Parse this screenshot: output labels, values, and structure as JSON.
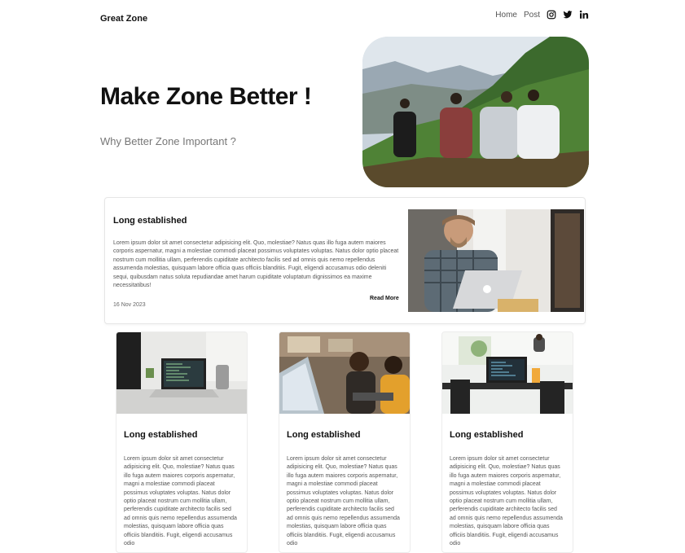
{
  "nav": {
    "brand": "Great Zone",
    "links": [
      "Home",
      "Post"
    ],
    "social_icons": [
      "instagram-icon",
      "twitter-icon",
      "linkedin-icon"
    ]
  },
  "hero": {
    "title": "Make Zone Better !",
    "subtitle": "Why Better Zone Important ?"
  },
  "feature": {
    "title": "Long established",
    "body": "Lorem ipsum dolor sit amet consectetur adipisicing elit. Quo, molestiae? Natus quas illo fuga autem maiores corporis aspernatur, magni a molestiae commodi placeat possimus voluptates voluptas. Natus dolor optio placeat nostrum cum mollitia ullam, perferendis cupiditate architecto facilis sed ad omnis quis nemo repellendus assumenda molestias, quisquam labore officia quas officiis blanditiis. Fugit, eligendi accusamus odio deleniti sequi, quibusdam natus soluta repudiandae amet harum cupiditate voluptatum dignissimos ea maxime necessitatibus!",
    "date": "16 Nov 2023",
    "read_more": "Read More"
  },
  "cards": [
    {
      "title": "Long established",
      "body": "Lorem ipsum dolor sit amet consectetur adipisicing elit. Quo, molestiae? Natus quas illo fuga autem maiores corporis aspernatur, magni a molestiae commodi placeat possimus voluptates voluptas. Natus dolor optio placeat nostrum cum mollitia ullam, perferendis cupiditate architecto facilis sed ad omnis quis nemo repellendus assumenda molestias, quisquam labore officia quas officiis blanditiis. Fugit, eligendi accusamus odio"
    },
    {
      "title": "Long established",
      "body": "Lorem ipsum dolor sit amet consectetur adipisicing elit. Quo, molestiae? Natus quas illo fuga autem maiores corporis aspernatur, magni a molestiae commodi placeat possimus voluptates voluptas. Natus dolor optio placeat nostrum cum mollitia ullam, perferendis cupiditate architecto facilis sed ad omnis quis nemo repellendus assumenda molestias, quisquam labore officia quas officiis blanditiis. Fugit, eligendi accusamus odio"
    },
    {
      "title": "Long established",
      "body": "Lorem ipsum dolor sit amet consectetur adipisicing elit. Quo, molestiae? Natus quas illo fuga autem maiores corporis aspernatur, magni a molestiae commodi placeat possimus voluptates voluptas. Natus dolor optio placeat nostrum cum mollitia ullam, perferendis cupiditate architecto facilis sed ad omnis quis nemo repellendus assumenda molestias, quisquam labore officia quas officiis blanditiis. Fugit, eligendi accusamus odio"
    }
  ]
}
